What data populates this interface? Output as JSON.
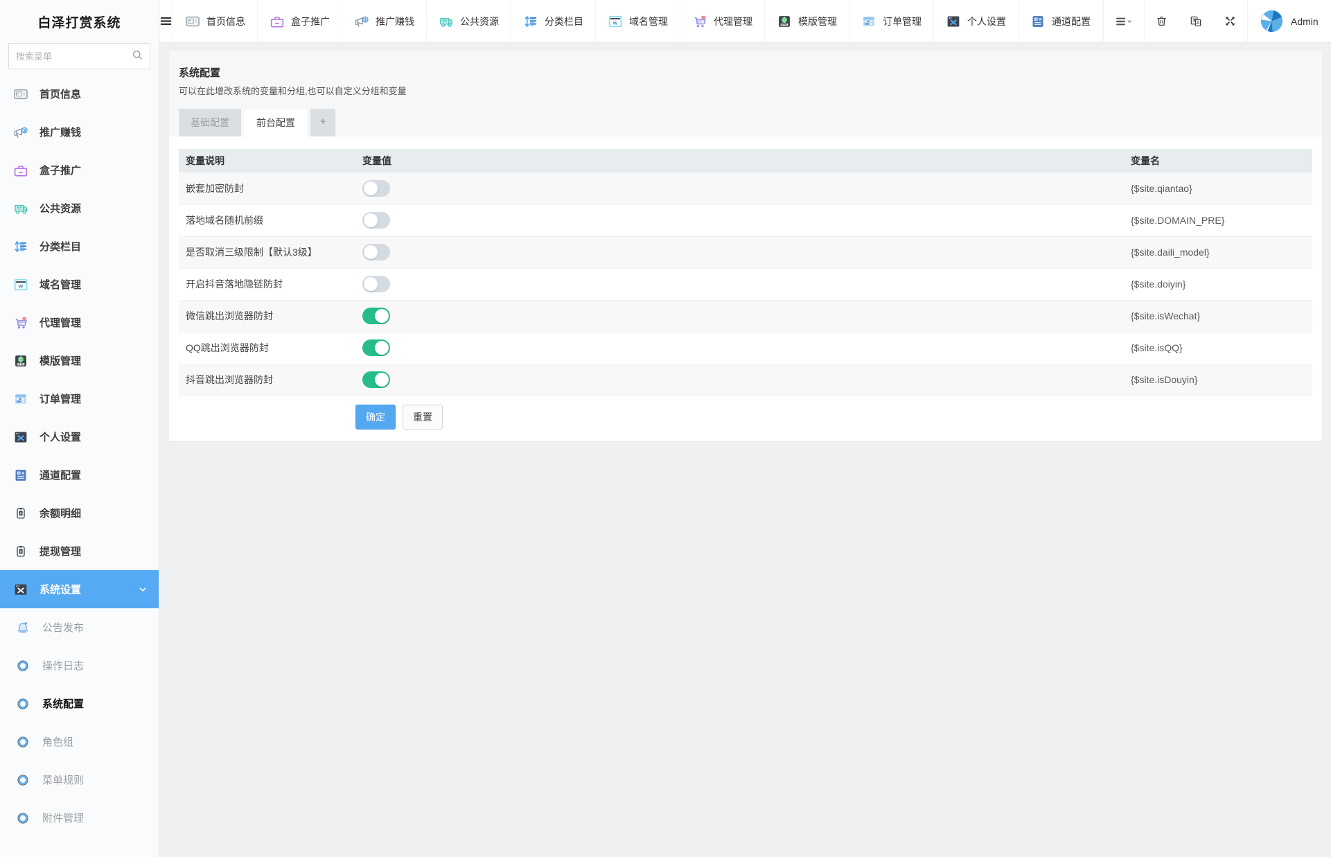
{
  "app": {
    "title": "白泽打赏系统",
    "search_placeholder": "搜索菜单"
  },
  "colors": {
    "accent": "#55aaf3",
    "toggle_on": "#26bd8b",
    "toggle_off": "#d6dbe1",
    "confirm_button": "#54a8f0",
    "table_header_bg": "#e8ecef"
  },
  "sidebar": {
    "items": [
      {
        "id": "home-info",
        "label": "首页信息",
        "icon": "home-icon"
      },
      {
        "id": "promo-earn",
        "label": "推广赚钱",
        "icon": "megaphone-icon"
      },
      {
        "id": "box-promo",
        "label": "盒子推广",
        "icon": "box-icon"
      },
      {
        "id": "public-res",
        "label": "公共资源",
        "icon": "store-icon"
      },
      {
        "id": "category",
        "label": "分类栏目",
        "icon": "category-icon"
      },
      {
        "id": "domain",
        "label": "域名管理",
        "icon": "domain-icon"
      },
      {
        "id": "agent",
        "label": "代理管理",
        "icon": "cart-icon"
      },
      {
        "id": "template",
        "label": "模版管理",
        "icon": "template-icon"
      },
      {
        "id": "order",
        "label": "订单管理",
        "icon": "order-icon"
      },
      {
        "id": "profile",
        "label": "个人设置",
        "icon": "profile-icon"
      },
      {
        "id": "channel",
        "label": "通道配置",
        "icon": "channel-icon"
      },
      {
        "id": "balance",
        "label": "余额明细",
        "icon": "balance-icon"
      },
      {
        "id": "withdraw",
        "label": "提现管理",
        "icon": "withdraw-icon"
      },
      {
        "id": "system",
        "label": "系统设置",
        "icon": "system-icon",
        "active": true,
        "expanded": true,
        "children": [
          {
            "id": "announce",
            "label": "公告发布",
            "icon": "bell-icon"
          },
          {
            "id": "op-log",
            "label": "操作日志",
            "icon": "ring-icon"
          },
          {
            "id": "sys-config",
            "label": "系统配置",
            "icon": "ring-icon",
            "active": true
          },
          {
            "id": "role-group",
            "label": "角色组",
            "icon": "ring-icon"
          },
          {
            "id": "menu-rule",
            "label": "菜单规则",
            "icon": "ring-icon"
          },
          {
            "id": "attachment",
            "label": "附件管理",
            "icon": "ring-icon"
          }
        ]
      }
    ]
  },
  "navbar": {
    "tabs": [
      {
        "id": "home-info",
        "label": "首页信息",
        "icon": "home-icon"
      },
      {
        "id": "box-promo",
        "label": "盒子推广",
        "icon": "box-icon"
      },
      {
        "id": "promo-earn",
        "label": "推广赚钱",
        "icon": "megaphone-icon"
      },
      {
        "id": "public-res",
        "label": "公共资源",
        "icon": "store-icon"
      },
      {
        "id": "category",
        "label": "分类栏目",
        "icon": "category-icon"
      },
      {
        "id": "domain",
        "label": "域名管理",
        "icon": "domain-icon"
      },
      {
        "id": "agent",
        "label": "代理管理",
        "icon": "cart-icon"
      },
      {
        "id": "template",
        "label": "模版管理",
        "icon": "template-icon"
      },
      {
        "id": "order",
        "label": "订单管理",
        "icon": "order-icon"
      },
      {
        "id": "profile",
        "label": "个人设置",
        "icon": "profile-icon"
      },
      {
        "id": "channel",
        "label": "通道配置",
        "icon": "channel-icon"
      }
    ],
    "actions": [
      {
        "id": "tab-list",
        "icon": "list-icon",
        "bordered": true
      },
      {
        "id": "clear-cache",
        "icon": "trash-icon",
        "bordered": true
      },
      {
        "id": "translate",
        "icon": "translate-icon",
        "bordered": false
      },
      {
        "id": "fullscreen",
        "icon": "expand-icon",
        "bordered": false
      }
    ],
    "user": {
      "name": "Admin"
    }
  },
  "main": {
    "title": "系统配置",
    "subtitle": "可以在此增改系统的变量和分组,也可以自定义分组和变量",
    "tabs": [
      {
        "id": "base-config",
        "label": "基础配置"
      },
      {
        "id": "front-config",
        "label": "前台配置",
        "active": true
      },
      {
        "id": "add-tab",
        "label": "+",
        "add": true
      }
    ],
    "table": {
      "headers": [
        "变量说明",
        "变量值",
        "变量名"
      ],
      "rows": [
        {
          "desc": "嵌套加密防封",
          "value": false,
          "name": "{$site.qiantao}"
        },
        {
          "desc": "落地域名随机前缀",
          "value": false,
          "name": "{$site.DOMAIN_PRE}"
        },
        {
          "desc": "是否取消三级限制【默认3级】",
          "value": false,
          "name": "{$site.daili_model}"
        },
        {
          "desc": "开启抖音落地隐链防封",
          "value": false,
          "name": "{$site.doiyin}"
        },
        {
          "desc": "微信跳出浏览器防封",
          "value": true,
          "name": "{$site.isWechat}"
        },
        {
          "desc": "QQ跳出浏览器防封",
          "value": true,
          "name": "{$site.isQQ}"
        },
        {
          "desc": "抖音跳出浏览器防封",
          "value": true,
          "name": "{$site.isDouyin}"
        }
      ]
    },
    "buttons": {
      "confirm": "确定",
      "reset": "重置"
    }
  }
}
